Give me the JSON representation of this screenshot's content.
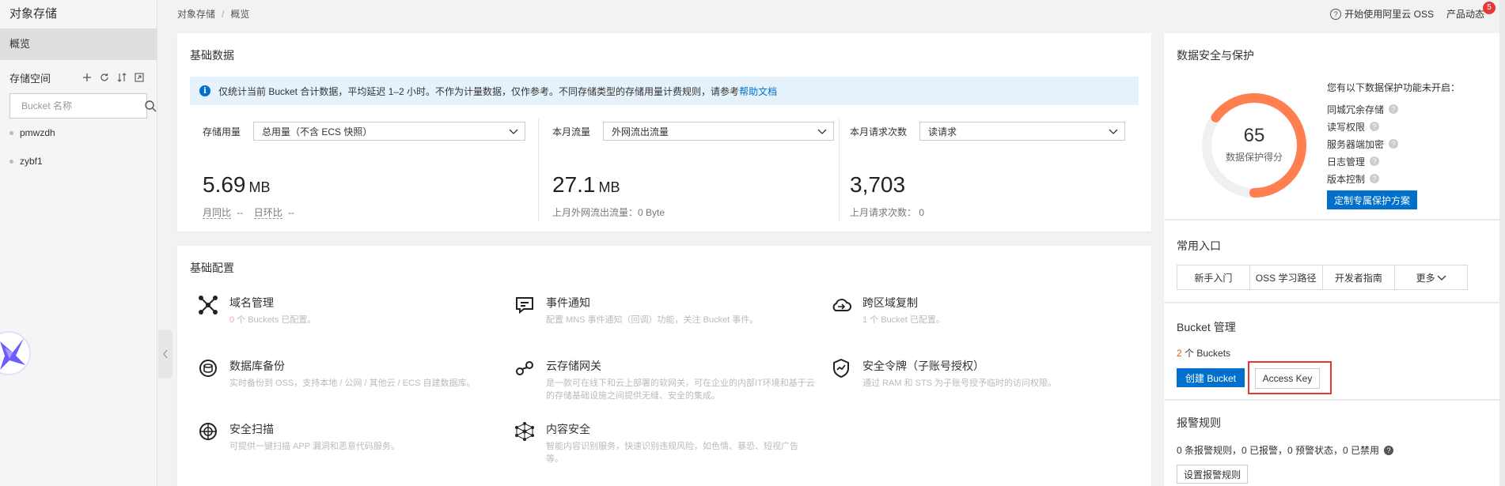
{
  "sidebar": {
    "title": "对象存储",
    "overview": "概览",
    "bucket_section_label": "存储空间",
    "search_placeholder": "Bucket 名称",
    "buckets": [
      "pmwzdh",
      "zybf1"
    ]
  },
  "header": {
    "breadcrumb_root": "对象存储",
    "breadcrumb_sep": "/",
    "breadcrumb_current": "概览",
    "start_link": "开始使用阿里云 OSS",
    "news_label": "产品动态",
    "news_badge": "5"
  },
  "basic_data": {
    "title": "基础数据",
    "notice_text": "仅统计当前 Bucket 合计数据，平均延迟 1–2 小时。不作为计量数据，仅作参考。不同存储类型的存储用量计费规则，请参考",
    "notice_link": "帮助文档",
    "storage": {
      "label": "存储用量",
      "select": "总用量（不含 ECS 快照）",
      "value": "5.69",
      "unit": "MB",
      "mom_label": "月同比",
      "mom_value": "--",
      "dod_label": "日环比",
      "dod_value": "--"
    },
    "traffic": {
      "label": "本月流量",
      "select": "外网流出流量",
      "value": "27.1",
      "unit": "MB",
      "sub": "上月外网流出流量：0 Byte"
    },
    "requests": {
      "label": "本月请求次数",
      "select": "读请求",
      "value": "3,703",
      "sub": "上月请求次数：  0"
    }
  },
  "basic_config": {
    "title": "基础配置",
    "features": [
      {
        "name": "域名管理",
        "num": "0",
        "desc": " 个 Buckets 已配置。"
      },
      {
        "name": "事件通知",
        "num": "",
        "desc": "配置 MNS 事件通知（回调）功能，关注 Bucket 事件。"
      },
      {
        "name": "跨区域复制",
        "num": "",
        "desc": "1 个 Bucket 已配置。"
      },
      {
        "name": "数据库备份",
        "num": "",
        "desc": "实时备份到 OSS，支持本地 / 公网 / 其他云 / ECS 自建数据库。"
      },
      {
        "name": "云存储网关",
        "num": "",
        "desc": "是一款可在线下和云上部署的软网关，可在企业的内部IT环境和基于云的存储基础设施之间提供无缝、安全的集成。"
      },
      {
        "name": "安全令牌（子账号授权）",
        "num": "",
        "desc": "通过 RAM 和 STS 为子账号授予临时的访问权限。"
      },
      {
        "name": "安全扫描",
        "num": "",
        "desc": "可提供一键扫描 APP 漏洞和恶意代码服务。"
      },
      {
        "name": "内容安全",
        "num": "",
        "desc": "智能内容识别服务，快速识别违规风险，如色情、暴恐、短视广告等。"
      }
    ]
  },
  "protection": {
    "title": "数据安全与保护",
    "score": "65",
    "score_caption": "数据保护得分",
    "score_fraction": 0.65,
    "list_head": "您有以下数据保护功能未开启：",
    "items": [
      "同城冗余存储",
      "读写权限",
      "服务器端加密",
      "日志管理",
      "版本控制"
    ],
    "button": "定制专属保护方案",
    "gauge_color": "#ff7f50"
  },
  "common_entry": {
    "title": "常用入口",
    "items": [
      "新手入门",
      "OSS 学习路径",
      "开发者指南",
      "更多"
    ]
  },
  "bucket_mgmt": {
    "title": "Bucket 管理",
    "count_num": "2",
    "count_text": " 个 Buckets",
    "create_button": "创建 Bucket",
    "access_key_button": "Access Key"
  },
  "alarm": {
    "title": "报警规则",
    "stats": "0 条报警规则，0 已报警，0 预警状态，0 已禁用",
    "set_button": "设置报警规则"
  }
}
